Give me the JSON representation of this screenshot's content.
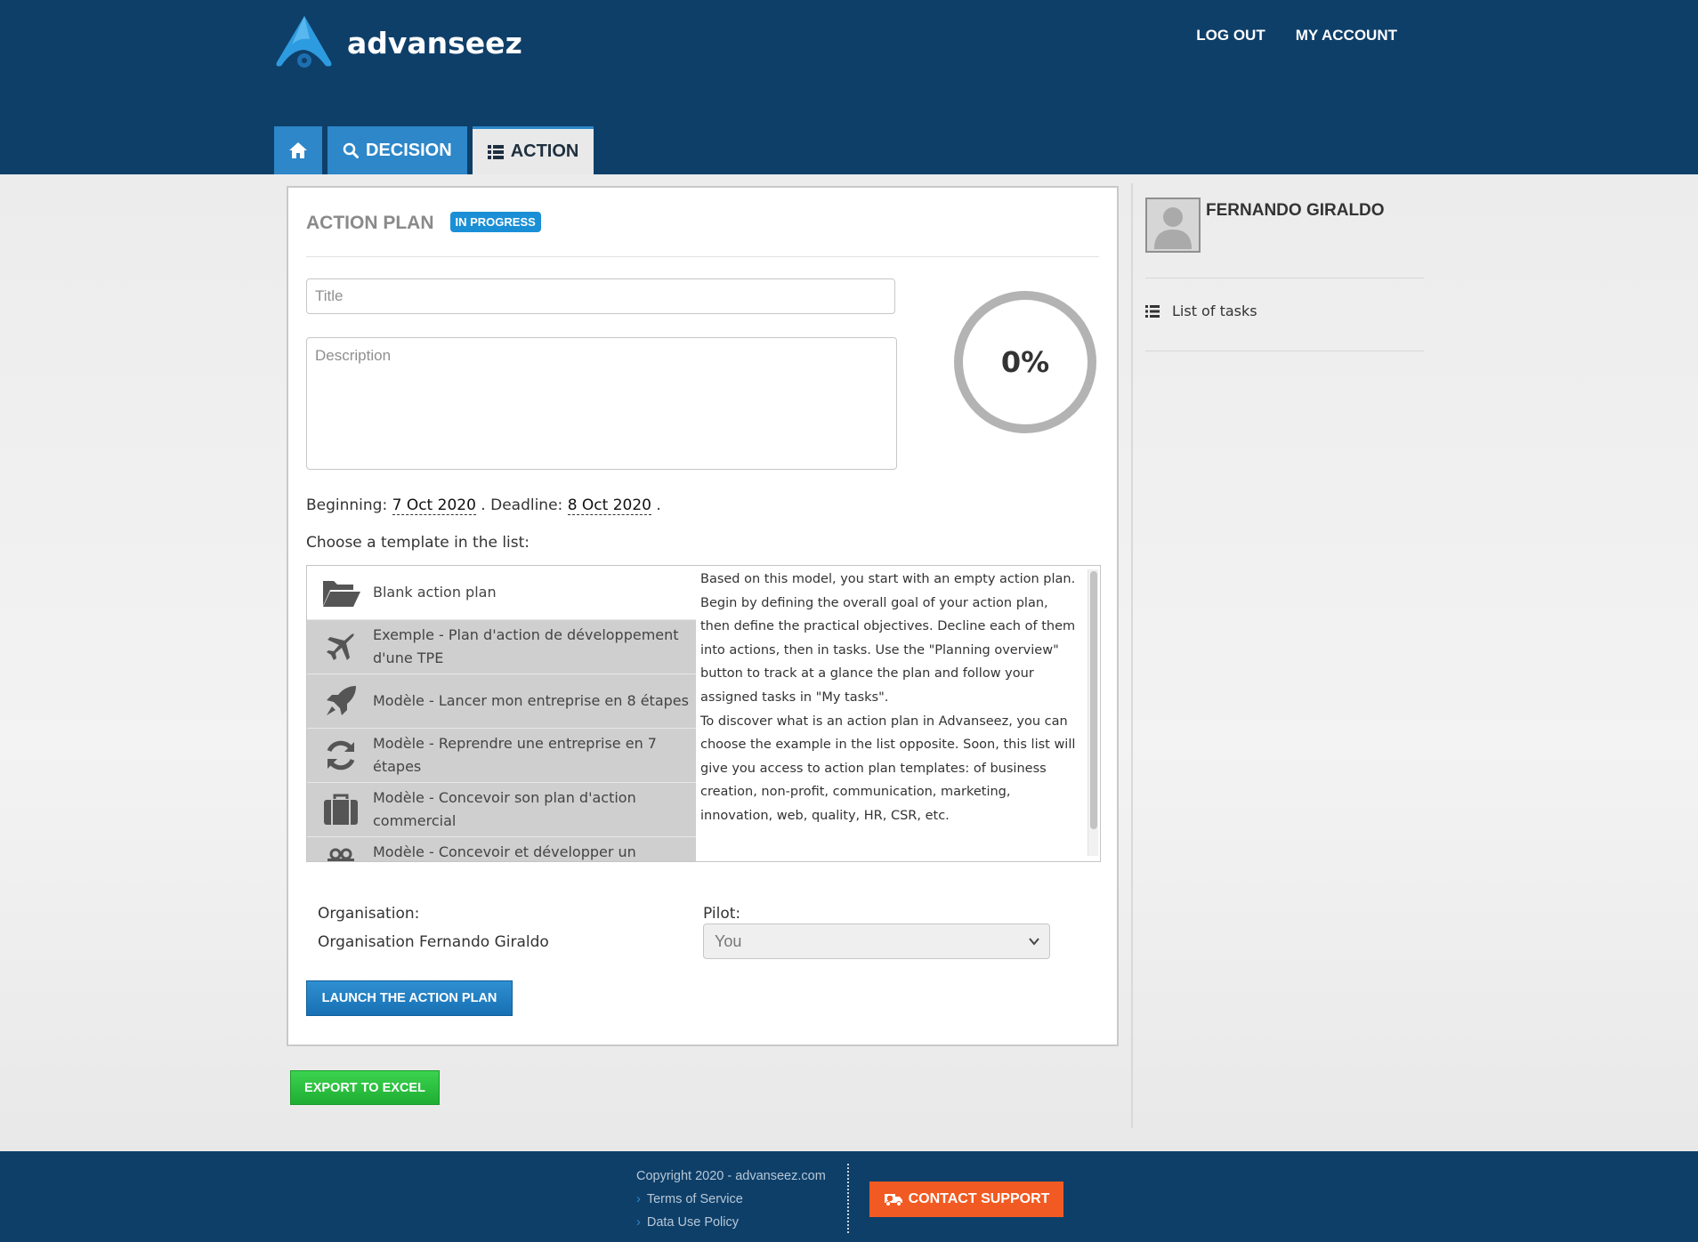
{
  "app": {
    "name": "advanseez"
  },
  "header": {
    "links": [
      "LOG OUT",
      "MY ACCOUNT"
    ],
    "tabs": [
      {
        "label": "",
        "icon": "home-icon"
      },
      {
        "label": "DECISION",
        "icon": "search-icon"
      },
      {
        "label": "ACTION",
        "icon": "list-icon",
        "active": true
      }
    ]
  },
  "main": {
    "title": "ACTION PLAN",
    "status_badge": "IN PROGRESS",
    "title_placeholder": "Title",
    "description_placeholder": "Description",
    "progress_percent": 0,
    "progress_label": "0%",
    "beginning_label": "Beginning:",
    "beginning_date": "7 Oct 2020",
    "deadline_label": ". Deadline:",
    "deadline_date": "8 Oct 2020",
    "date_end": ".",
    "choose_label": "Choose a template in the list:",
    "templates": [
      {
        "label": "Blank action plan",
        "icon": "folder-open-icon"
      },
      {
        "label": "Exemple - Plan d'action de développement d'une TPE",
        "icon": "plane-icon"
      },
      {
        "label": "Modèle - Lancer mon entreprise en 8 étapes",
        "icon": "rocket-icon"
      },
      {
        "label": "Modèle - Reprendre une entreprise en 7 étapes",
        "icon": "refresh-icon"
      },
      {
        "label": "Modèle - Concevoir son plan d'action commercial",
        "icon": "briefcase-icon"
      },
      {
        "label": "Modèle - Concevoir et développer un nouveau",
        "icon": "gift-icon"
      }
    ],
    "template_description": [
      "Based on this model, you start with an empty action plan. Begin by defining the overall goal of your action plan, then define the practical objectives. Decline each of them into actions, then in tasks. Use the \"Planning overview\" button to track at a glance the plan and follow your assigned tasks in \"My tasks\".",
      "To discover what is an action plan in Advanseez, you can choose the example in the list opposite. Soon, this list will give you access to action plan templates: of business creation, non-profit, communication, marketing, innovation, web, quality, HR, CSR, etc."
    ],
    "organisation_label": "Organisation:",
    "organisation_value": "Organisation Fernando Giraldo",
    "pilot_label": "Pilot:",
    "pilot_selected": "You",
    "launch_button": "LAUNCH THE ACTION PLAN",
    "export_button": "EXPORT TO EXCEL"
  },
  "sidebar": {
    "user_name": "FERNANDO GIRALDO",
    "items": [
      {
        "label": "List of tasks",
        "icon": "list-icon"
      }
    ]
  },
  "footer": {
    "copyright": "Copyright 2020 - advanseez.com",
    "links": [
      "Terms of Service",
      "Data Use Policy"
    ],
    "support_button": "CONTACT SUPPORT"
  },
  "colors": {
    "header_bg": "#0e3f69",
    "accent_blue": "#2d87c9",
    "badge_blue": "#1b8fd6",
    "export_green": "#22b536",
    "support_orange": "#f15a22"
  }
}
